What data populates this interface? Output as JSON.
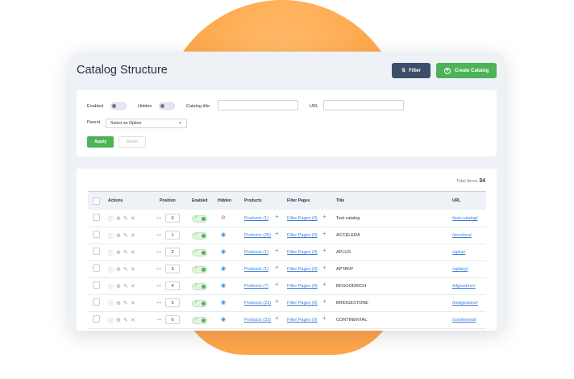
{
  "header": {
    "title": "Catalog Structure",
    "filter_label": "Filter",
    "create_label": "Create Catalog"
  },
  "filters": {
    "enabled_label": "Enabled",
    "hidden_label": "Hidden",
    "catalog_title_label": "Catalog title",
    "url_label": "URL",
    "parent_label": "Parent",
    "parent_selected": "Select an Option",
    "apply_label": "Apply",
    "reset_label": "Reset"
  },
  "table": {
    "total_label": "Total Items",
    "total_value": "34",
    "headers": {
      "actions": "Actions",
      "position": "Position",
      "enabled": "Enabled",
      "hidden": "Hidden",
      "products": "Products",
      "filter_pages": "Filter Pages",
      "title": "Title",
      "url": "URL"
    },
    "rows": [
      {
        "position": "0",
        "products": "Products (1)",
        "filter_pages": "Filter Pages (0)",
        "title": "Test catalog",
        "url": "/test-catalog/",
        "hidden": true
      },
      {
        "position": "1",
        "products": "Products (26)",
        "filter_pages": "Filter Pages (0)",
        "title": "ACCELERA",
        "url": "/accelera/",
        "hidden": false
      },
      {
        "position": "2",
        "products": "Products (1)",
        "filter_pages": "Filter Pages (0)",
        "title": "APLUS",
        "url": "/aplus/",
        "hidden": false
      },
      {
        "position": "3",
        "products": "Products (1)",
        "filter_pages": "Filter Pages (0)",
        "title": "APTANY",
        "url": "/aptany/",
        "hidden": false
      },
      {
        "position": "4",
        "products": "Products (7)",
        "filter_pages": "Filter Pages (0)",
        "title": "BFGOODRICH",
        "url": "/bfgoodrich/",
        "hidden": false
      },
      {
        "position": "5",
        "products": "Products (23)",
        "filter_pages": "Filter Pages (0)",
        "title": "BRIDGESTONE",
        "url": "/bridgestone/",
        "hidden": false
      },
      {
        "position": "6",
        "products": "Products (23)",
        "filter_pages": "Filter Pages (0)",
        "title": "CONTINENTAL",
        "url": "/continental/",
        "hidden": false
      }
    ]
  },
  "colors": {
    "accent_green": "#4cb356",
    "dark_button": "#3d4e6a",
    "link": "#3a7fdc",
    "background_blob": "#ffa94d"
  },
  "icons": [
    "sliders-icon",
    "plus-circle-icon",
    "info-icon",
    "zoom-icon",
    "edit-icon",
    "close-icon",
    "eye-icon",
    "eye-off-icon",
    "arrow-icon",
    "check-icon",
    "plus-icon",
    "chevron-down-icon"
  ]
}
